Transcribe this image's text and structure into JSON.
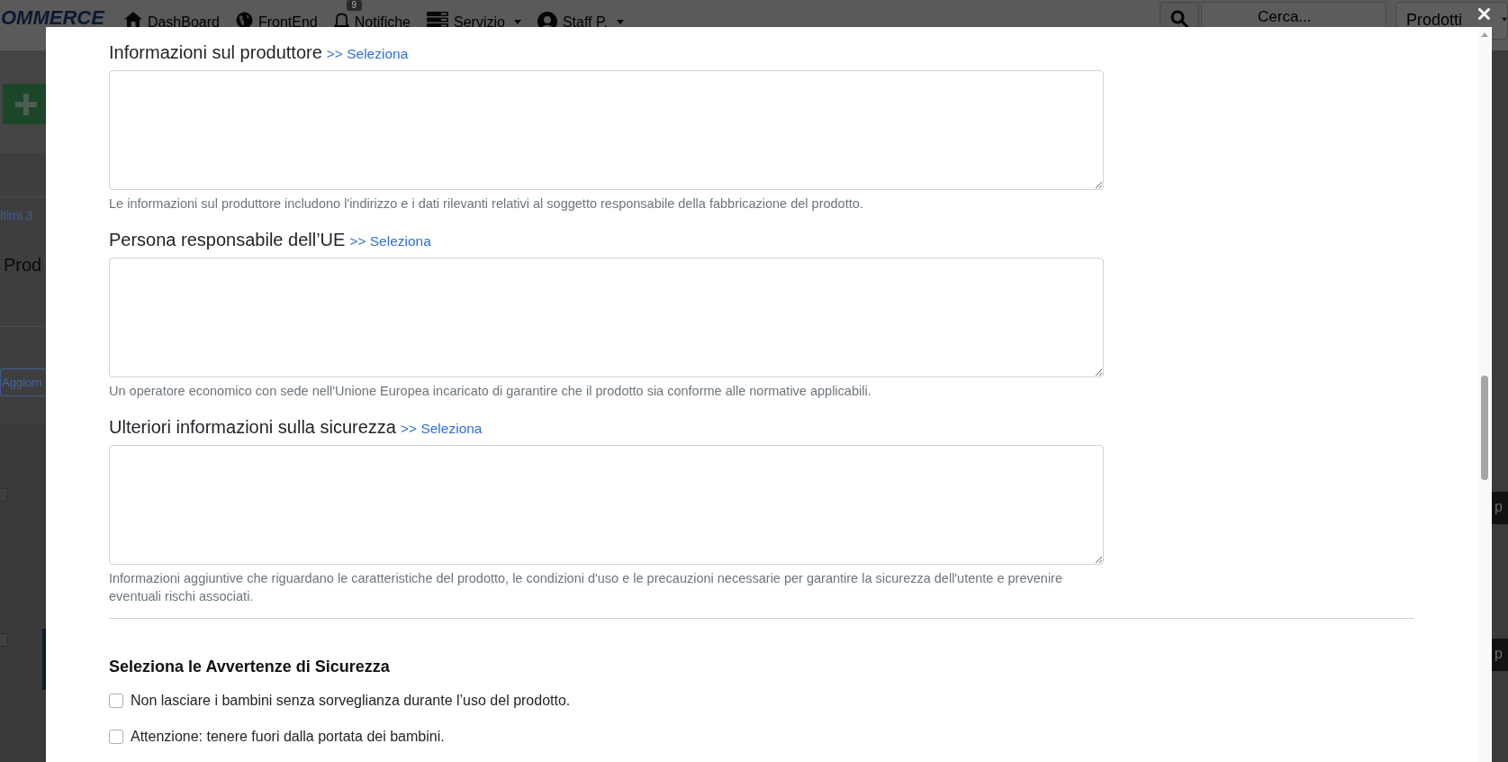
{
  "background_page": {
    "header": {
      "logo": "OMMERCE",
      "nav": [
        {
          "label": "DashBoard",
          "dropdown": false
        },
        {
          "label": "FrontEnd",
          "dropdown": false
        },
        {
          "label": "Notifiche",
          "badge": "9",
          "dropdown": false
        },
        {
          "label": "Servizio",
          "dropdown": true
        },
        {
          "label": "Staff P.",
          "dropdown": true
        }
      ],
      "search": {
        "placeholder": "Cerca..."
      },
      "select": {
        "value": "Prodotti"
      }
    },
    "side": {
      "link": "ltimi 3",
      "title": "Prod",
      "button": "Aggiorn",
      "row_checkboxes": [
        {
          "checked": false
        },
        {
          "checked": false
        }
      ],
      "edge_labels": [
        "p",
        "p"
      ]
    }
  },
  "modal": {
    "fields": [
      {
        "label": "Informazioni sul produttore",
        "link": ">> Seleziona",
        "help": "Le informazioni sul produttore includono l'indirizzo e i dati rilevanti relativi al soggetto responsabile della fabbricazione del prodotto."
      },
      {
        "label": "Persona responsabile dell’UE",
        "link": ">> Seleziona",
        "help": "Un operatore economico con sede nell'Unione Europea incaricato di garantire che il prodotto sia conforme alle normative applicabili."
      },
      {
        "label": "Ulteriori informazioni sulla sicurezza",
        "link": ">> Seleziona",
        "help": "Informazioni aggiuntive che riguardano le caratteristiche del prodotto, le condizioni d'uso e le precauzioni necessarie per garantire la sicurezza dell'utente e prevenire eventuali rischi associati."
      }
    ],
    "warnings": {
      "title": "Seleziona le Avvertenze di Sicurezza",
      "items": [
        {
          "label": "Non lasciare i bambini senza sorveglianza durante l’uso del prodotto.",
          "checked": false
        },
        {
          "label": "Attenzione: tenere fuori dalla portata dei bambini.",
          "checked": false
        }
      ]
    }
  }
}
